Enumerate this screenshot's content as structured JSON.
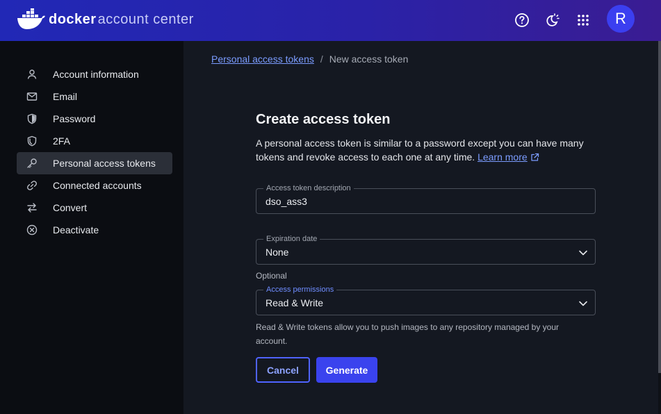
{
  "header": {
    "brand": "docker",
    "product": "account center",
    "avatar_initial": "R",
    "icons": [
      "help-icon",
      "theme-toggle-icon",
      "apps-grid-icon"
    ]
  },
  "sidebar": {
    "items": [
      {
        "label": "Account information",
        "icon": "user-icon"
      },
      {
        "label": "Email",
        "icon": "mail-icon"
      },
      {
        "label": "Password",
        "icon": "shield-icon"
      },
      {
        "label": "2FA",
        "icon": "shield-check-icon"
      },
      {
        "label": "Personal access tokens",
        "icon": "key-icon",
        "active": true
      },
      {
        "label": "Connected accounts",
        "icon": "link-icon"
      },
      {
        "label": "Convert",
        "icon": "swap-icon"
      },
      {
        "label": "Deactivate",
        "icon": "cancel-circle-icon"
      }
    ]
  },
  "breadcrumb": {
    "parent": "Personal access tokens",
    "separator": "/",
    "current": "New access token"
  },
  "form": {
    "title": "Create access token",
    "description": "A personal access token is similar to a password except you can have many tokens and revoke access to each one at any time.",
    "learn_more": "Learn more",
    "description_field": {
      "label": "Access token description",
      "value": "dso_ass3"
    },
    "expiration_field": {
      "label": "Expiration date",
      "value": "None"
    },
    "optional_text": "Optional",
    "permissions_field": {
      "label": "Access permissions",
      "value": "Read & Write"
    },
    "permissions_help": "Read & Write tokens allow you to push images to any repository managed by your account.",
    "cancel_label": "Cancel",
    "generate_label": "Generate"
  },
  "colors": {
    "accent": "#3a43ee",
    "link": "#7b9cff",
    "header_gradient_start": "#2128b6",
    "header_gradient_end": "#3a1c92"
  }
}
